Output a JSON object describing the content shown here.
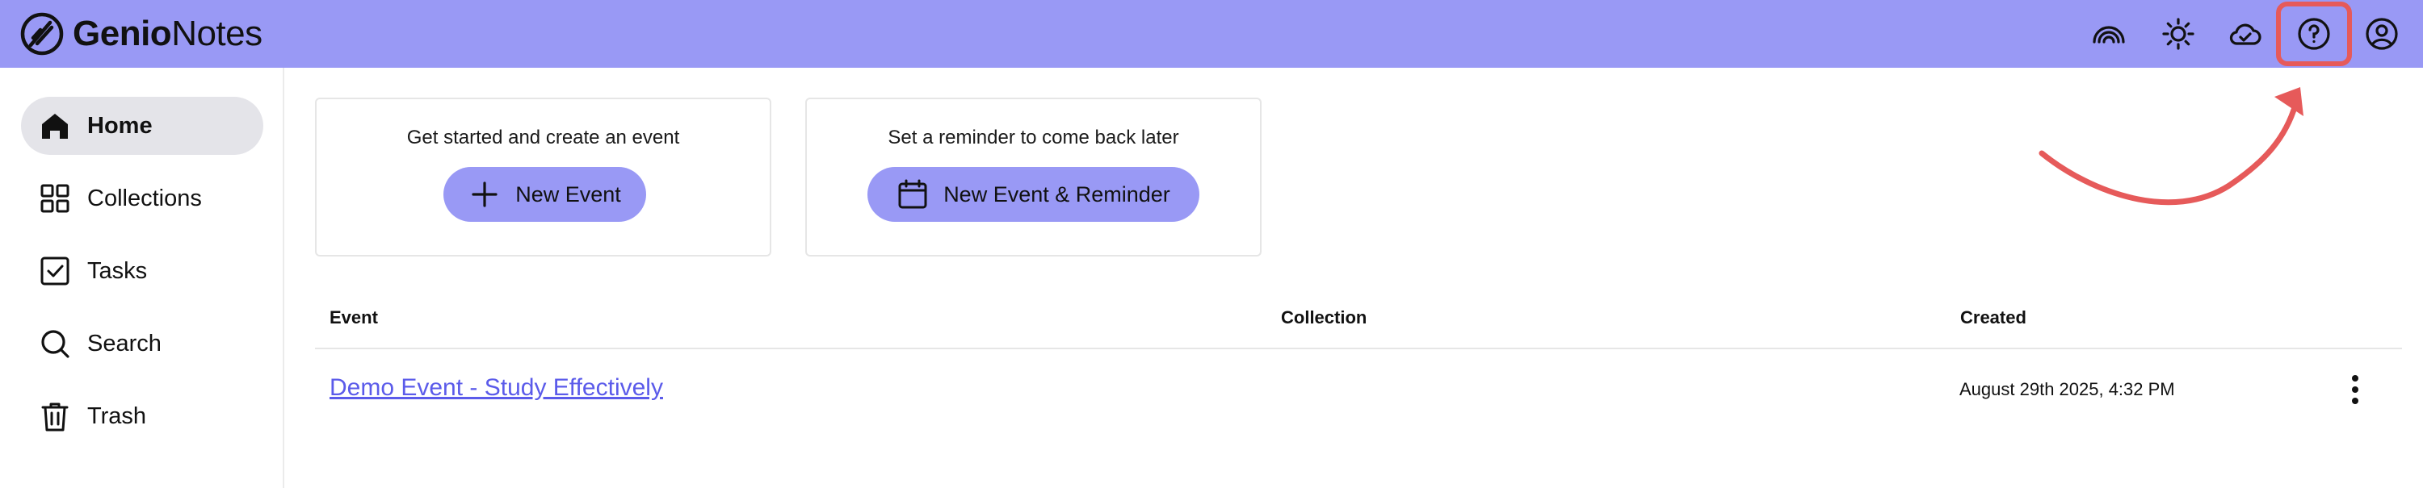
{
  "app": {
    "name_bold": "Genio",
    "name_light": "Notes"
  },
  "header": {
    "icons": [
      "rainbow-icon",
      "sun-icon",
      "cloud-check-icon",
      "help-icon",
      "account-icon"
    ],
    "highlight_color": "#e65a5a",
    "accent": "#9999f5"
  },
  "sidebar": {
    "items": [
      {
        "label": "Home",
        "icon": "home-icon",
        "active": true
      },
      {
        "label": "Collections",
        "icon": "grid-icon",
        "active": false
      },
      {
        "label": "Tasks",
        "icon": "checkbox-icon",
        "active": false
      },
      {
        "label": "Search",
        "icon": "search-icon",
        "active": false
      },
      {
        "label": "Trash",
        "icon": "trash-icon",
        "active": false
      }
    ]
  },
  "cards": [
    {
      "title": "Get started and create an event",
      "button_label": "New Event",
      "icon": "plus-icon"
    },
    {
      "title": "Set a reminder to come back later",
      "button_label": "New Event & Reminder",
      "icon": "calendar-icon"
    }
  ],
  "table": {
    "headers": {
      "event": "Event",
      "collection": "Collection",
      "created": "Created"
    },
    "rows": [
      {
        "event": "Demo Event - Study Effectively",
        "collection": "",
        "created": "August 29th 2025, 4:32 PM"
      }
    ]
  },
  "link_color": "#5b5bea"
}
